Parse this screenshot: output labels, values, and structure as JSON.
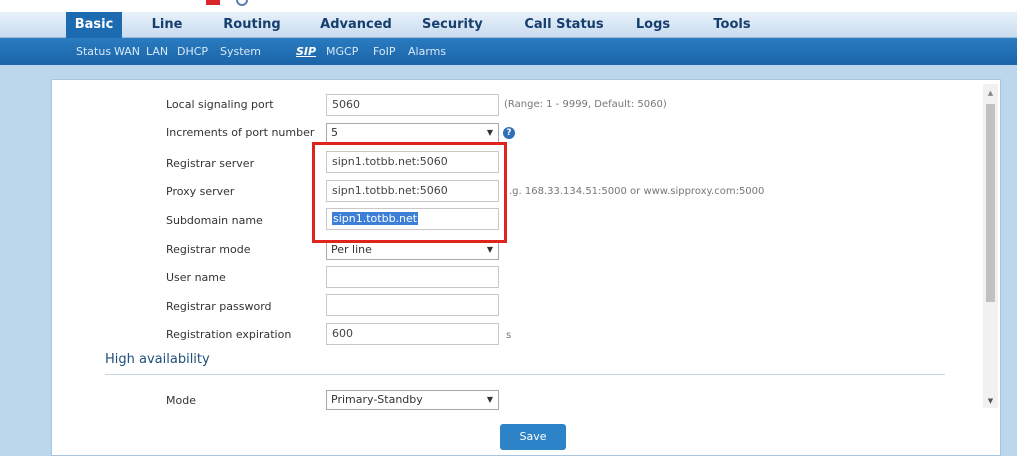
{
  "main_nav": [
    "Basic",
    "Line",
    "Routing",
    "Advanced",
    "Security",
    "Call Status",
    "Logs",
    "Tools"
  ],
  "main_nav_active": "Basic",
  "sub_nav": [
    "Status",
    "WAN",
    "LAN",
    "DHCP",
    "System",
    "SIP",
    "MGCP",
    "FoIP",
    "Alarms"
  ],
  "sub_nav_active": "SIP",
  "form": {
    "local_port_label": "Local signaling port",
    "local_port_value": "5060",
    "local_port_hint": "(Range: 1 - 9999, Default: 5060)",
    "increments_label": "Increments of port number",
    "increments_value": "5",
    "registrar_server_label": "Registrar server",
    "registrar_server_value": "sipn1.totbb.net:5060",
    "proxy_server_label": "Proxy server",
    "proxy_server_value": "sipn1.totbb.net:5060",
    "proxy_server_hint": ".g. 168.33.134.51:5000 or www.sipproxy.com:5000",
    "subdomain_label": "Subdomain name",
    "subdomain_value": "sipn1.totbb.net",
    "registrar_mode_label": "Registrar mode",
    "registrar_mode_value": "Per line",
    "user_name_label": "User name",
    "user_name_value": "",
    "registrar_password_label": "Registrar password",
    "registrar_password_value": "",
    "registration_expiration_label": "Registration expiration",
    "registration_expiration_value": "600",
    "registration_expiration_unit": "s"
  },
  "high_availability": {
    "title": "High availability",
    "mode_label": "Mode",
    "mode_value": "Primary-Standby"
  },
  "save_label": "Save",
  "icons": {
    "help": "help-icon",
    "dropdown": "chevron-down-icon"
  },
  "colors": {
    "active_tab": "#1c6bb0",
    "subnav": "#1f6db2",
    "highlight_box": "#e1231d",
    "save_button": "#2d83c8"
  }
}
